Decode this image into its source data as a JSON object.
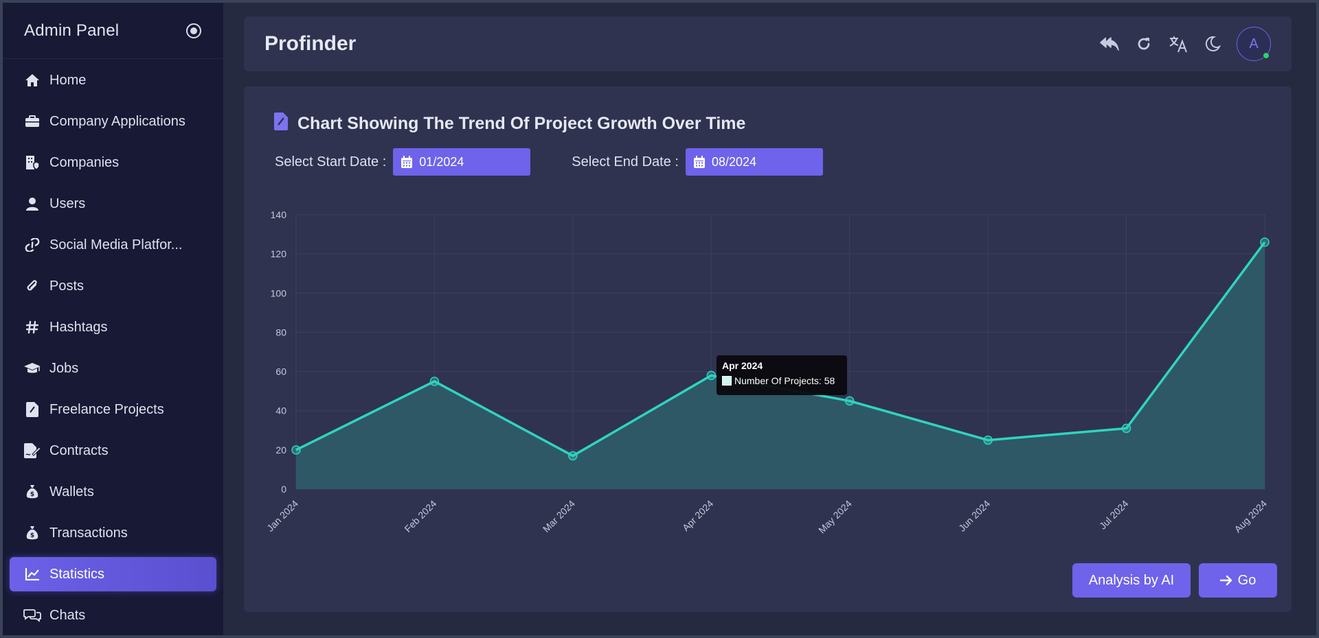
{
  "sidebar": {
    "title": "Admin Panel",
    "items": [
      {
        "label": "Home",
        "icon": "home-icon"
      },
      {
        "label": "Company Applications",
        "icon": "briefcase-icon"
      },
      {
        "label": "Companies",
        "icon": "building-icon"
      },
      {
        "label": "Users",
        "icon": "user-icon"
      },
      {
        "label": "Social Media Platfor...",
        "icon": "link-icon"
      },
      {
        "label": "Posts",
        "icon": "paperclip-icon"
      },
      {
        "label": "Hashtags",
        "icon": "hashtag-icon"
      },
      {
        "label": "Jobs",
        "icon": "graduation-cap-icon"
      },
      {
        "label": "Freelance Projects",
        "icon": "file-icon"
      },
      {
        "label": "Contracts",
        "icon": "file-signature-icon"
      },
      {
        "label": "Wallets",
        "icon": "money-bag-icon"
      },
      {
        "label": "Transactions",
        "icon": "money-bag-icon"
      },
      {
        "label": "Statistics",
        "icon": "chart-line-icon",
        "active": true
      },
      {
        "label": "Chats",
        "icon": "chats-icon"
      }
    ]
  },
  "header": {
    "brand": "Profinder",
    "avatar_letter": "A"
  },
  "card": {
    "title": "Chart Showing The Trend Of Project Growth Over Time",
    "start_label": "Select Start Date :",
    "start_value": "01/2024",
    "end_label": "Select End Date :",
    "end_value": "08/2024",
    "ai_button": "Analysis by AI",
    "go_button": "Go"
  },
  "tooltip": {
    "title": "Apr 2024",
    "label": "Number Of Projects: 58"
  },
  "colors": {
    "accent": "#6e63ea",
    "line": "#2fd4bf",
    "fill": "#2e5f6a"
  },
  "chart_data": {
    "type": "area",
    "categories": [
      "Jan 2024",
      "Feb 2024",
      "Mar 2024",
      "Apr 2024",
      "May 2024",
      "Jun 2024",
      "Jul 2024",
      "Aug 2024"
    ],
    "series": [
      {
        "name": "Number Of Projects",
        "values": [
          20,
          55,
          17,
          58,
          45,
          25,
          31,
          126
        ]
      }
    ],
    "ylim": [
      0,
      140
    ],
    "yticks": [
      0,
      20,
      40,
      60,
      80,
      100,
      120,
      140
    ],
    "grid": true
  }
}
